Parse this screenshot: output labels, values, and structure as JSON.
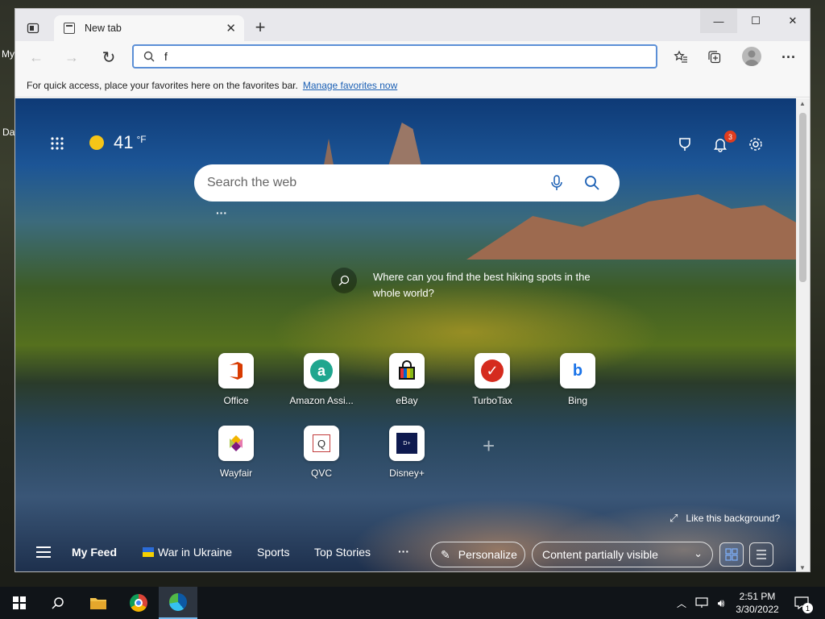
{
  "desktop": {
    "label1": "My",
    "label2": "Da"
  },
  "browser": {
    "tab_title": "New tab",
    "tab_close": "✕",
    "new_tab": "+",
    "window": {
      "minimize": "—",
      "maximize": "☐",
      "close": "✕"
    },
    "address_value": "f",
    "favorites_bar": {
      "message": "For quick access, place your favorites here on the favorites bar.",
      "link": "Manage favorites now"
    }
  },
  "newtab": {
    "weather": {
      "temp": "41",
      "unit": "°F"
    },
    "notifications_count": "3",
    "search_placeholder": "Search the web",
    "more": "···",
    "tip": "Where can you find the best hiking spots in the whole world?",
    "quick_links": [
      {
        "label": "Office",
        "icon": "office-icon"
      },
      {
        "label": "Amazon Assi...",
        "icon": "amazon-icon"
      },
      {
        "label": "eBay",
        "icon": "ebay-icon"
      },
      {
        "label": "TurboTax",
        "icon": "turbotax-icon"
      },
      {
        "label": "Bing",
        "icon": "bing-icon"
      },
      {
        "label": "Wayfair",
        "icon": "wayfair-icon"
      },
      {
        "label": "QVC",
        "icon": "qvc-icon"
      },
      {
        "label": "Disney+",
        "icon": "disney-icon"
      }
    ],
    "add": "+",
    "like_bg": "Like this background?",
    "feed": {
      "my_feed": "My Feed",
      "tabs": [
        "War in Ukraine",
        "Sports",
        "Top Stories"
      ],
      "more": "···",
      "personalize": "Personalize",
      "content": "Content partially visible"
    }
  },
  "taskbar": {
    "time": "2:51 PM",
    "date": "3/30/2022",
    "notif_count": "1"
  }
}
